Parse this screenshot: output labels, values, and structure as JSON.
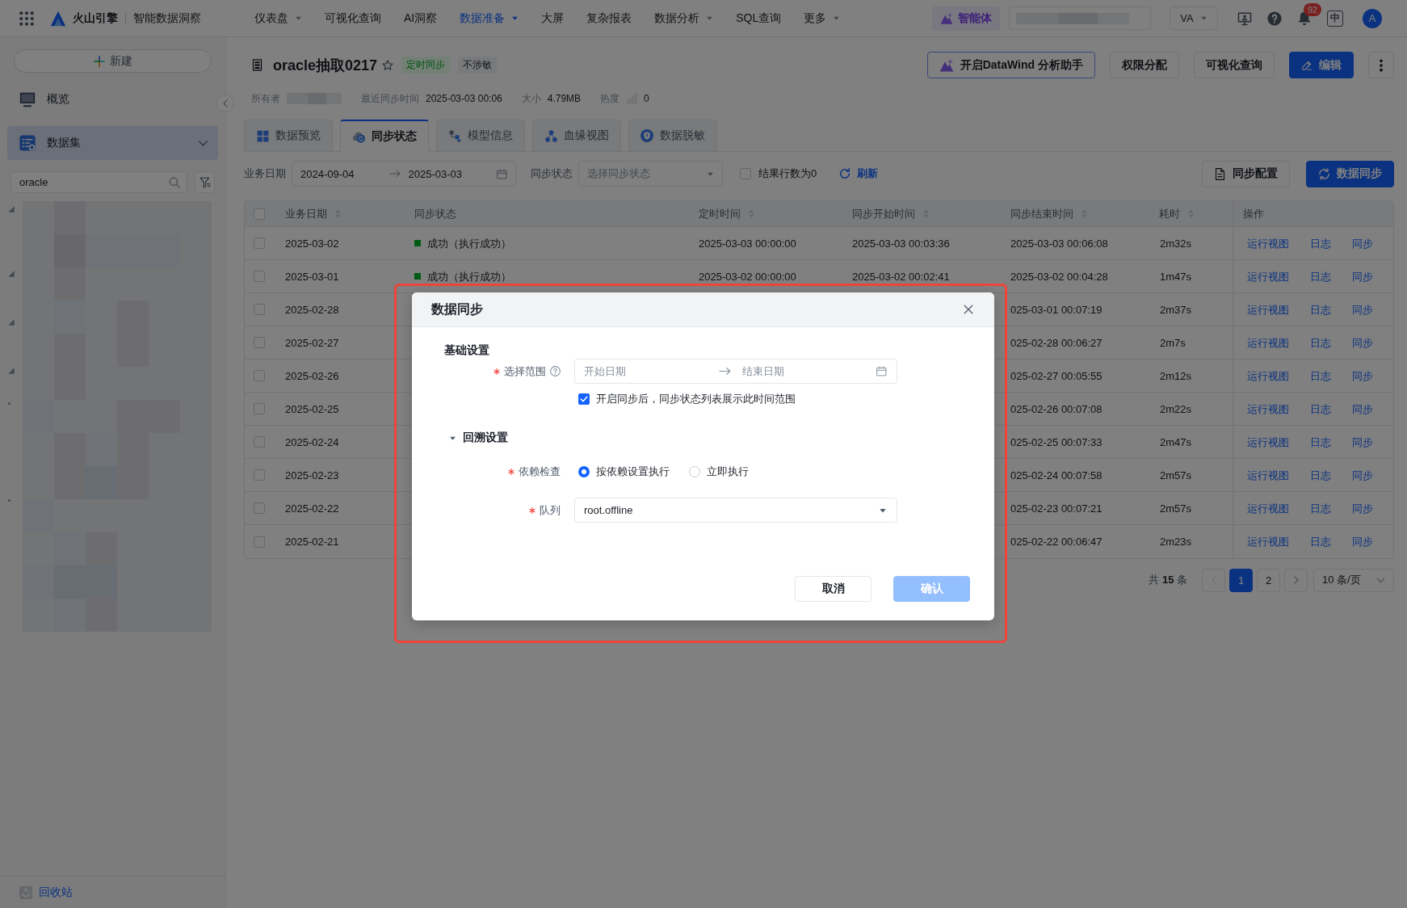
{
  "top_bar": {
    "brand": "火山引擎",
    "product": "智能数据洞察",
    "nav": [
      {
        "label": "仪表盘",
        "dropdown": true,
        "selected": false
      },
      {
        "label": "可视化查询",
        "dropdown": false,
        "selected": false
      },
      {
        "label": "AI洞察",
        "dropdown": false,
        "selected": false
      },
      {
        "label": "数据准备",
        "dropdown": true,
        "selected": true
      },
      {
        "label": "大屏",
        "dropdown": false,
        "selected": false
      },
      {
        "label": "复杂报表",
        "dropdown": false,
        "selected": false
      },
      {
        "label": "数据分析",
        "dropdown": true,
        "selected": false
      },
      {
        "label": "SQL查询",
        "dropdown": false,
        "selected": false
      },
      {
        "label": "更多",
        "dropdown": true,
        "selected": false
      }
    ],
    "agent_button": "智能体",
    "workspace_menu": "VA",
    "notification_count": "92",
    "language": "中",
    "avatar_initial": "A"
  },
  "sidebar": {
    "new_button": "新建",
    "items": [
      {
        "label": "概览",
        "kind": "overview",
        "selected": false
      },
      {
        "label": "数据集",
        "kind": "dataset",
        "selected": true,
        "expanded": true
      }
    ],
    "search": {
      "value": "oracle"
    },
    "recycle_bin": "回收站"
  },
  "header": {
    "title": "oracle抽取0217",
    "starred": false,
    "tags": [
      {
        "label": "定时同步",
        "kind": "success"
      },
      {
        "label": "不涉敏",
        "kind": "neutral"
      }
    ],
    "actions": [
      {
        "label": "开启DataWind 分析助手",
        "kind": "assistant"
      },
      {
        "label": "权限分配",
        "kind": "default"
      },
      {
        "label": "可视化查询",
        "kind": "default"
      },
      {
        "label": "编辑",
        "kind": "edit"
      }
    ],
    "meta": [
      {
        "label": "所有者",
        "kind": "owner"
      },
      {
        "label": "最近同步时间",
        "kind": "text",
        "value": "2025-03-03 00:06"
      },
      {
        "label": "大小",
        "kind": "text",
        "value": "4.79MB"
      },
      {
        "label": "热度",
        "kind": "heat",
        "value": "0"
      }
    ]
  },
  "tabs": [
    {
      "label": "数据预览",
      "kind": "preview",
      "selected": false
    },
    {
      "label": "同步状态",
      "kind": "sync",
      "selected": true
    },
    {
      "label": "模型信息",
      "kind": "model",
      "selected": false
    },
    {
      "label": "血缘视图",
      "kind": "lineage",
      "selected": false
    },
    {
      "label": "数据脱敏",
      "kind": "masking",
      "selected": false
    }
  ],
  "filters": {
    "date": {
      "label": "业务日期",
      "start": "2024-09-04",
      "end": "2025-03-03"
    },
    "status": {
      "label": "同步状态",
      "placeholder": "选择同步状态"
    },
    "zero_rows": {
      "label": "结果行数为0",
      "checked": false
    },
    "refresh": "刷新",
    "buttons": [
      {
        "label": "同步配置",
        "kind": "config"
      },
      {
        "label": "数据同步",
        "kind": "sync"
      }
    ]
  },
  "table": {
    "all_checked": false,
    "columns": [
      {
        "label": "业务日期",
        "sortable": true
      },
      {
        "label": "同步状态",
        "sortable": false
      },
      {
        "label": "定时时间",
        "sortable": true
      },
      {
        "label": "同步开始时间",
        "sortable": true
      },
      {
        "label": "同步结束时间",
        "sortable": true
      },
      {
        "label": "耗时",
        "sortable": true
      },
      {
        "label": "操作",
        "sortable": false
      }
    ],
    "rows": [
      {
        "checked": false,
        "date": "2025-03-02",
        "status": {
          "label": "成功（执行成功）",
          "kind": "success"
        },
        "scheduled": "2025-03-03 00:00:00",
        "start": "2025-03-03 00:03:36",
        "end": "2025-03-03 00:06:08",
        "duration": "2m32s",
        "actions": [
          "运行视图",
          "日志",
          "同步"
        ]
      },
      {
        "checked": false,
        "date": "2025-03-01",
        "status": {
          "label": "成功（执行成功）",
          "kind": "success"
        },
        "scheduled": "2025-03-02 00:00:00",
        "start": "2025-03-02 00:02:41",
        "end": "2025-03-02 00:04:28",
        "duration": "1m47s",
        "actions": [
          "运行视图",
          "日志",
          "同步"
        ]
      },
      {
        "checked": false,
        "date": "2025-02-28",
        "end": "025-03-01 00:07:19",
        "duration": "2m37s",
        "actions": [
          "运行视图",
          "日志",
          "同步"
        ]
      },
      {
        "checked": false,
        "date": "2025-02-27",
        "end": "025-02-28 00:06:27",
        "duration": "2m7s",
        "actions": [
          "运行视图",
          "日志",
          "同步"
        ]
      },
      {
        "checked": false,
        "date": "2025-02-26",
        "end": "025-02-27 00:05:55",
        "duration": "2m12s",
        "actions": [
          "运行视图",
          "日志",
          "同步"
        ]
      },
      {
        "checked": false,
        "date": "2025-02-25",
        "end": "025-02-26 00:07:08",
        "duration": "2m22s",
        "actions": [
          "运行视图",
          "日志",
          "同步"
        ]
      },
      {
        "checked": false,
        "date": "2025-02-24",
        "end": "025-02-25 00:07:33",
        "duration": "2m47s",
        "actions": [
          "运行视图",
          "日志",
          "同步"
        ]
      },
      {
        "checked": false,
        "date": "2025-02-23",
        "end": "025-02-24 00:07:58",
        "duration": "2m57s",
        "actions": [
          "运行视图",
          "日志",
          "同步"
        ]
      },
      {
        "checked": false,
        "date": "2025-02-22",
        "end": "025-02-23 00:07:21",
        "duration": "2m57s",
        "actions": [
          "运行视图",
          "日志",
          "同步"
        ]
      },
      {
        "checked": false,
        "date": "2025-02-21",
        "end": "025-02-22 00:06:47",
        "duration": "2m23s",
        "actions": [
          "运行视图",
          "日志",
          "同步"
        ]
      }
    ]
  },
  "pagination": {
    "total": "共 **15** 条",
    "prev_disabled": true,
    "next_disabled": false,
    "pages": [
      {
        "label": "1",
        "selected": true
      },
      {
        "label": "2",
        "selected": false
      }
    ],
    "page_size": "10 条/页"
  },
  "dialog": {
    "title": "数据同步",
    "basic_heading": "基础设置",
    "range": {
      "label": "选择范围",
      "required": true,
      "start_placeholder": "开始日期",
      "end_placeholder": "结束日期"
    },
    "show_range": {
      "label": "开启同步后，同步状态列表展示此时间范围",
      "checked": true
    },
    "backfill": {
      "heading": "回溯设置",
      "expanded": true,
      "dependency": {
        "label": "依赖检查",
        "required": true,
        "options": [
          {
            "label": "按依赖设置执行",
            "selected": true
          },
          {
            "label": "立即执行",
            "selected": false
          }
        ]
      },
      "queue": {
        "label": "队列",
        "required": true,
        "value": "root.offline"
      }
    },
    "buttons": [
      {
        "label": "取消",
        "kind": "cancel",
        "disabled": false
      },
      {
        "label": "确认",
        "kind": "confirm",
        "disabled": true
      }
    ]
  }
}
